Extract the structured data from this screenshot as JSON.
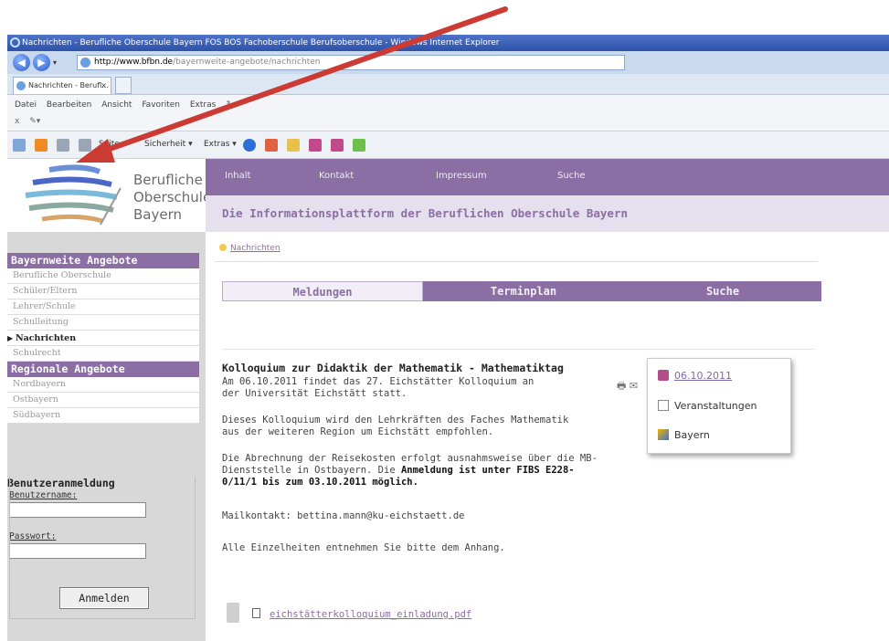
{
  "browser": {
    "window_title": "Nachrichten - Berufliche Oberschule Bayern FOS BOS Fachoberschule Berufsoberschule - Windows Internet Explorer",
    "address_host": "http://www.bfbn.de",
    "address_path": "/bayernweite-angebote/nachrichten",
    "tab_label": "Nachrichten - Berufl...",
    "tab_close": "×",
    "menu": [
      "Datei",
      "Bearbeiten",
      "Ansicht",
      "Favoriten",
      "Extras",
      "?"
    ],
    "menu_sub": "x",
    "commands": {
      "seite": "Seite ▾",
      "sicherheit": "Sicherheit ▾",
      "extras": "Extras ▾"
    }
  },
  "site": {
    "logo_line1": "Berufliche",
    "logo_line2": "Oberschule",
    "logo_line3": "Bayern",
    "topnav": [
      "Inhalt",
      "Kontakt",
      "Impressum",
      "Suche"
    ],
    "tagline": "Die Informationsplattform der Beruflichen Oberschule Bayern"
  },
  "sidebar": {
    "section1_title": "Bayernweite Angebote",
    "section1_items": [
      "Berufliche Oberschule",
      "Schüler/Eltern",
      "Lehrer/Schule",
      "Schulleitung",
      "Nachrichten",
      "Schulrecht"
    ],
    "section2_title": "Regionale Angebote",
    "section2_items": [
      "Nordbayern",
      "Ostbayern",
      "Südbayern"
    ],
    "login_title": "Benutzeranmeldung",
    "username_label": "Benutzername:",
    "password_label": "Passwort:",
    "login_button": "Anmelden"
  },
  "content": {
    "breadcrumb": "Nachrichten",
    "tabs": [
      "Meldungen",
      "Terminplan",
      "Suche"
    ],
    "article_title": "Kolloquium zur Didaktik der Mathematik - Mathematiktag",
    "p1_l1": "Am 06.10.2011 findet das 27. Eichstätter Kolloquium an",
    "p1_l2": "der Universität Eichstätt statt.",
    "p2_l1": "Dieses Kolloquium wird den Lehrkräften des Faches Mathematik",
    "p2_l2": "aus der weiteren Region um Eichstätt empfohlen.",
    "p3_l1": "Die Abrechnung der Reisekosten erfolgt ausnahmsweise über die MB-",
    "p3_l2a": "Dienststelle in Ostbayern. Die ",
    "p3_l2b": "Anmeldung ist unter FIBS E228-",
    "p3_l3": "0/11/1 bis zum 03.10.2011 möglich.",
    "mail": "Mailkontakt: bettina.mann@ku-eichstaett.de",
    "details": "Alle Einzelheiten entnehmen Sie bitte dem Anhang.",
    "attachment": "eichstätterkolloquium_einladung.pdf",
    "info_date": "06.10.2011",
    "info_category": "Veranstaltungen",
    "info_region": "Bayern"
  },
  "colors": {
    "brand_purple": "#8a6ea4",
    "annotation_arrow": "#cc3b33"
  }
}
